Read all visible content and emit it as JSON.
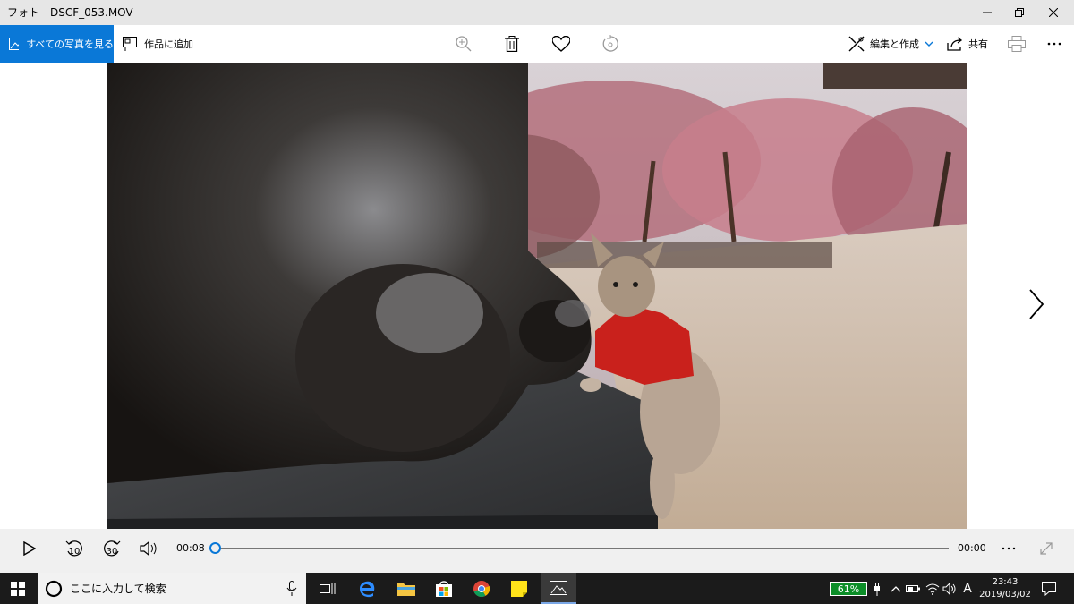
{
  "window": {
    "title": "フォト - DSCF_053.MOV"
  },
  "toolbar": {
    "view_all_label": "すべての写真を見る",
    "add_to_label": "作品に追加",
    "edit_create_label": "編集と作成",
    "share_label": "共有"
  },
  "player": {
    "elapsed": "00:08",
    "remaining": "00:00",
    "skip_back": "10",
    "skip_forward": "30",
    "progress_fraction": 0.0
  },
  "taskbar": {
    "search_placeholder": "ここに入力して検索",
    "battery": "61%",
    "ime": "A",
    "time": "23:43",
    "date": "2019/03/02"
  },
  "colors": {
    "accent": "#0a78d7",
    "titlebar": "#e6e6e6",
    "taskbar": "#1b1b1b",
    "controls": "#f0f0f0"
  }
}
